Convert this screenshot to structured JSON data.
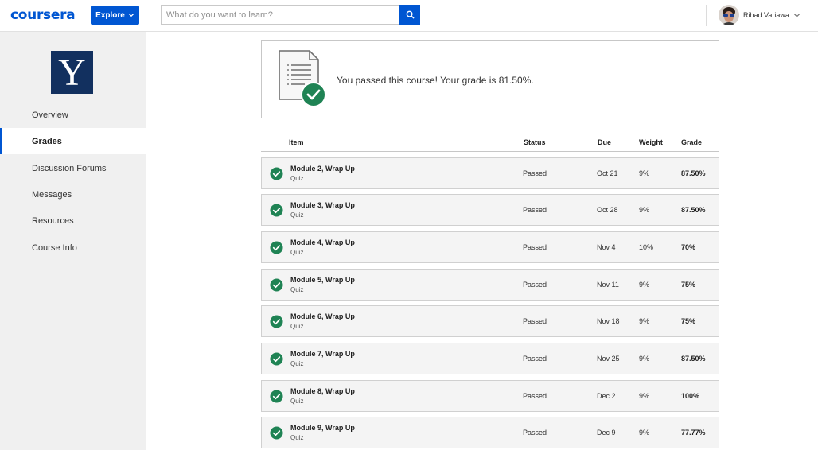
{
  "header": {
    "logo": "coursera",
    "explore_label": "Explore",
    "search_placeholder": "What do you want to learn?",
    "user_name": "Rihad Variawa"
  },
  "sidebar": {
    "logo_letter": "Y",
    "items": [
      {
        "label": "Overview",
        "active": false
      },
      {
        "label": "Grades",
        "active": true
      },
      {
        "label": "Discussion Forums",
        "active": false
      },
      {
        "label": "Messages",
        "active": false
      },
      {
        "label": "Resources",
        "active": false
      },
      {
        "label": "Course Info",
        "active": false
      }
    ]
  },
  "banner": {
    "message": "You passed this course! Your grade is 81.50%."
  },
  "table": {
    "headers": {
      "item": "Item",
      "status": "Status",
      "due": "Due",
      "weight": "Weight",
      "grade": "Grade"
    },
    "rows": [
      {
        "title": "Module 2, Wrap Up",
        "type": "Quiz",
        "status": "Passed",
        "due": "Oct 21",
        "weight": "9%",
        "grade": "87.50%"
      },
      {
        "title": "Module 3, Wrap Up",
        "type": "Quiz",
        "status": "Passed",
        "due": "Oct 28",
        "weight": "9%",
        "grade": "87.50%"
      },
      {
        "title": "Module 4, Wrap Up",
        "type": "Quiz",
        "status": "Passed",
        "due": "Nov 4",
        "weight": "10%",
        "grade": "70%"
      },
      {
        "title": "Module 5, Wrap Up",
        "type": "Quiz",
        "status": "Passed",
        "due": "Nov 11",
        "weight": "9%",
        "grade": "75%"
      },
      {
        "title": "Module 6, Wrap Up",
        "type": "Quiz",
        "status": "Passed",
        "due": "Nov 18",
        "weight": "9%",
        "grade": "75%"
      },
      {
        "title": "Module 7, Wrap Up",
        "type": "Quiz",
        "status": "Passed",
        "due": "Nov 25",
        "weight": "9%",
        "grade": "87.50%"
      },
      {
        "title": "Module 8, Wrap Up",
        "type": "Quiz",
        "status": "Passed",
        "due": "Dec 2",
        "weight": "9%",
        "grade": "100%"
      },
      {
        "title": "Module 9, Wrap Up",
        "type": "Quiz",
        "status": "Passed",
        "due": "Dec 9",
        "weight": "9%",
        "grade": "77.77%"
      }
    ]
  },
  "colors": {
    "brand": "#0056d2",
    "success": "#1f8354",
    "yale_blue": "#12305f"
  },
  "icons": {
    "explore": "chevron-down-icon",
    "search": "search-icon",
    "user_menu": "chevron-down-icon",
    "banner": "document-check-icon",
    "row_status": "check-circle-icon"
  }
}
